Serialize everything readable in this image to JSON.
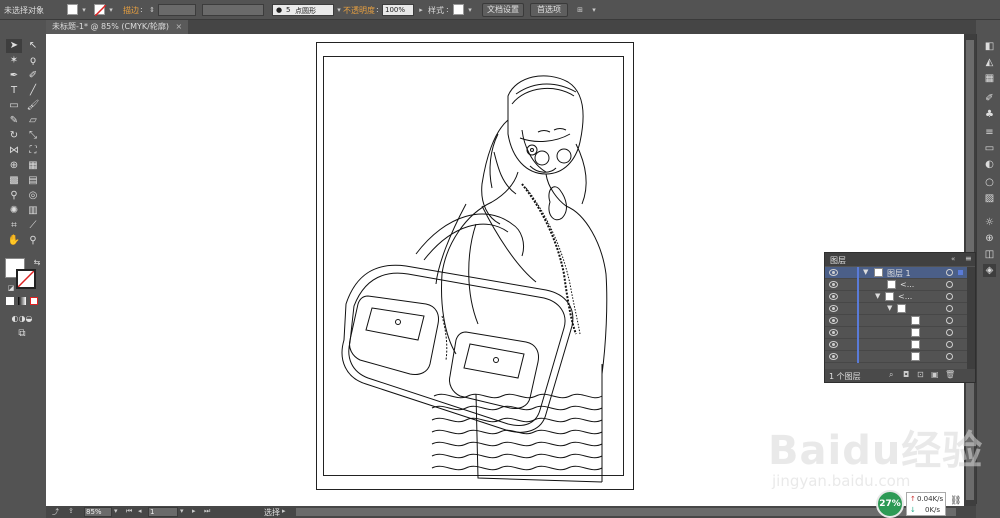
{
  "control_bar": {
    "selection": "未选择对象",
    "stroke_label": "描边",
    "brush_size": "5",
    "brush_type": "点圆形",
    "opacity_label": "不透明度",
    "opacity_value": "100%",
    "style_label": "样式",
    "doc_setup_button": "文档设置",
    "prefs_button": "首选项"
  },
  "document_tab": {
    "title": "未标题-1* @ 85% (CMYK/轮廓)",
    "close": "×"
  },
  "layers_panel": {
    "title": "图层",
    "rows": [
      {
        "name": "图层 1"
      },
      {
        "name": "<..."
      },
      {
        "name": "<..."
      },
      {
        "name": ""
      },
      {
        "name": ""
      },
      {
        "name": ""
      },
      {
        "name": ""
      },
      {
        "name": ""
      }
    ],
    "footer_count": "1 个图层"
  },
  "status_bar": {
    "zoom": "85%",
    "artboard_number": "1",
    "current_tool": "选择"
  },
  "net_monitor": {
    "percent": "27%",
    "upload": "0.04K/s",
    "download": "0K/s"
  },
  "watermark": {
    "brand": "Baidu经验",
    "url": "jingyan.baidu.com"
  },
  "colors": {
    "ui_bg": "#535353",
    "canvas": "#ffffff",
    "layer_accent": "#5a7bd8",
    "net_green": "#2d9a55"
  }
}
